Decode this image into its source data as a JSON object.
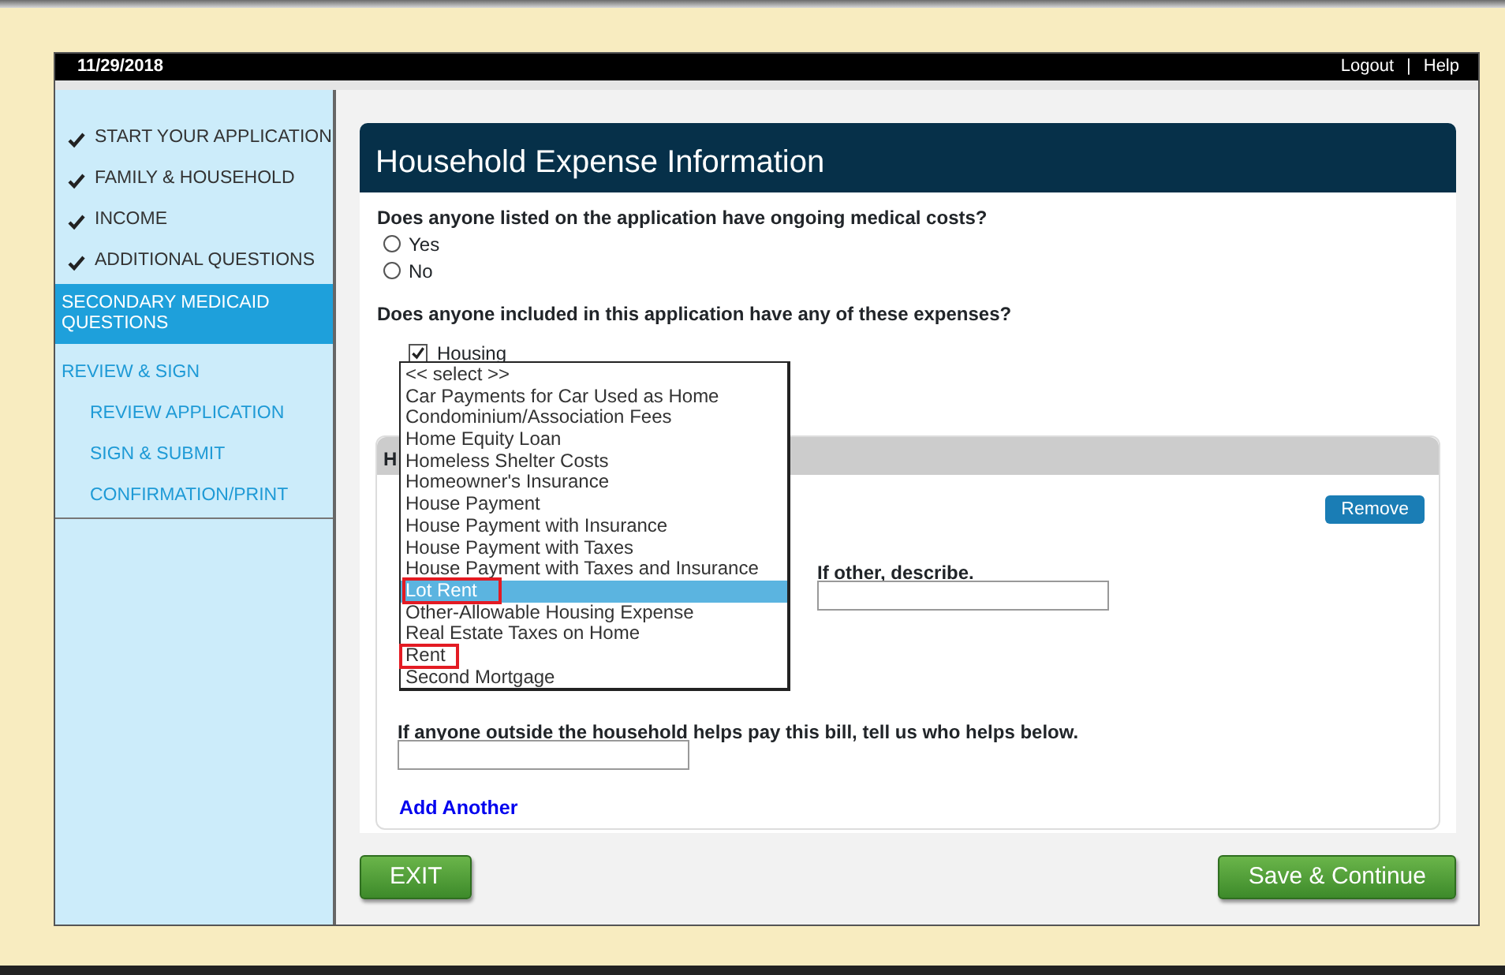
{
  "top_bar": {
    "date": "11/29/2018",
    "links": [
      "Logout",
      "Help"
    ],
    "separator": "|"
  },
  "sidebar": {
    "items": [
      {
        "label": "START YOUR APPLICATION",
        "completed": true,
        "selected": false
      },
      {
        "label": "FAMILY & HOUSEHOLD",
        "completed": true,
        "selected": false
      },
      {
        "label": "INCOME",
        "completed": true,
        "selected": false
      },
      {
        "label": "ADDITIONAL QUESTIONS",
        "completed": true,
        "selected": false
      },
      {
        "label": "SECONDARY MEDICAID QUESTIONS",
        "completed": false,
        "selected": true
      },
      {
        "label": "REVIEW & SIGN",
        "completed": false,
        "selected": false,
        "children": [
          {
            "label": "REVIEW APPLICATION",
            "completed": false,
            "selected": false
          },
          {
            "label": "SIGN & SUBMIT",
            "completed": false,
            "selected": false
          },
          {
            "label": "CONFIRMATION/PRINT",
            "completed": false,
            "selected": false
          }
        ]
      }
    ]
  },
  "panel": {
    "title": "Household Expense Information",
    "question_1": {
      "text": "Does anyone listed on the application have ongoing medical costs?",
      "options": [
        {
          "label": "Yes",
          "selected": false
        },
        {
          "label": "No",
          "selected": false
        }
      ]
    },
    "question_2": {
      "text": "Does anyone included in this application have any of these expenses?",
      "checkboxes": [
        {
          "label": "Housing",
          "checked": true
        }
      ]
    },
    "dropdown": {
      "options": [
        {
          "label": "<< select >>",
          "selected": false,
          "marked": false
        },
        {
          "label": "Car Payments for Car Used as Home",
          "selected": false,
          "marked": false
        },
        {
          "label": "Condominium/Association Fees",
          "selected": false,
          "marked": false
        },
        {
          "label": "Home Equity Loan",
          "selected": false,
          "marked": false
        },
        {
          "label": "Homeless Shelter Costs",
          "selected": false,
          "marked": false
        },
        {
          "label": "Homeowner's Insurance",
          "selected": false,
          "marked": false
        },
        {
          "label": "House Payment",
          "selected": false,
          "marked": false
        },
        {
          "label": "House Payment with Insurance",
          "selected": false,
          "marked": false
        },
        {
          "label": "House Payment with Taxes",
          "selected": false,
          "marked": false
        },
        {
          "label": "House Payment with Taxes and Insurance",
          "selected": false,
          "marked": false
        },
        {
          "label": "Lot Rent",
          "selected": true,
          "marked": true
        },
        {
          "label": "Other-Allowable Housing Expense",
          "selected": false,
          "marked": false
        },
        {
          "label": "Real Estate Taxes on Home",
          "selected": false,
          "marked": false
        },
        {
          "label": "Rent",
          "selected": false,
          "marked": true
        },
        {
          "label": "Second Mortgage",
          "selected": false,
          "marked": false
        }
      ]
    },
    "expense_section": {
      "title": "H",
      "remove_button": "Remove",
      "other_label": "If other, describe.",
      "helper_label": "If anyone outside the household helps pay this bill, tell us who helps below.",
      "add_link": "Add Another"
    }
  },
  "buttons": {
    "exit": "EXIT",
    "save": "Save & Continue"
  }
}
